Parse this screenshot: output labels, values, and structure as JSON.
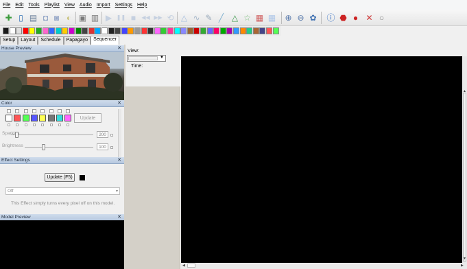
{
  "menu": [
    "File",
    "Edit",
    "Tools",
    "Playlist",
    "View",
    "Audio",
    "Import",
    "Settings",
    "Help"
  ],
  "toolbar_icons": [
    {
      "name": "new-sequence-icon",
      "glyph": "✚",
      "color": "#3a9a3a"
    },
    {
      "name": "new-document-icon",
      "glyph": "▯",
      "color": "#2d6fb5"
    },
    {
      "name": "open-folder-icon",
      "glyph": "▤",
      "color": "#6a7f9a"
    },
    {
      "name": "save-icon",
      "glyph": "◘",
      "color": "#8aa0c4"
    },
    {
      "name": "save-as-icon",
      "glyph": "◙",
      "color": "#98a8c8"
    },
    {
      "name": "refresh-icon",
      "glyph": "◐",
      "color": "#c9c27a"
    },
    {
      "name": "clipboard-icon",
      "glyph": "▣",
      "color": "#7a7a7a"
    },
    {
      "name": "paste-icon",
      "glyph": "▥",
      "color": "#777777"
    },
    {
      "name": "play-icon",
      "glyph": "▶",
      "color": "#c5d0e0"
    },
    {
      "name": "pause-icon",
      "glyph": "❚❚",
      "color": "#c5d0e0"
    },
    {
      "name": "stop-icon",
      "glyph": "■",
      "color": "#c5d0e0"
    },
    {
      "name": "rewind-icon",
      "glyph": "◀◀",
      "color": "#c5d0e0"
    },
    {
      "name": "fast-forward-icon",
      "glyph": "▶▶",
      "color": "#c5d0e0"
    },
    {
      "name": "loop-icon",
      "glyph": "⟲",
      "color": "#c5d0e0"
    },
    {
      "name": "triangle-icon",
      "glyph": "△",
      "color": "#a8c0e0"
    },
    {
      "name": "curve-icon",
      "glyph": "∿",
      "color": "#aabbcc"
    },
    {
      "name": "brush-icon",
      "glyph": "✎",
      "color": "#9aaabb"
    },
    {
      "name": "line-icon",
      "glyph": "╱",
      "color": "#7fb0d0"
    },
    {
      "name": "tree-icon",
      "glyph": "△",
      "color": "#3c9a4c"
    },
    {
      "name": "star-icon",
      "glyph": "☆",
      "color": "#7fc07f"
    },
    {
      "name": "colorful-grid-icon",
      "glyph": "▦",
      "color": "#d06060"
    },
    {
      "name": "light-grid-icon",
      "glyph": "▦",
      "color": "#b0c8e8"
    },
    {
      "name": "zoom-in-icon",
      "glyph": "⊕",
      "color": "#5577aa"
    },
    {
      "name": "zoom-out-icon",
      "glyph": "⊖",
      "color": "#5577aa"
    },
    {
      "name": "gear-icon",
      "glyph": "✿",
      "color": "#3d6fb0"
    },
    {
      "name": "info-icon",
      "glyph": "ⓘ",
      "color": "#1e5fbf"
    },
    {
      "name": "stop-sign-icon",
      "glyph": "⬣",
      "color": "#cc2222"
    },
    {
      "name": "stop-circle-icon",
      "glyph": "●",
      "color": "#cc2222"
    },
    {
      "name": "bulb-x-icon",
      "glyph": "✕",
      "color": "#cc3333"
    },
    {
      "name": "bulb-icon",
      "glyph": "○",
      "color": "#888888"
    }
  ],
  "effect_icon_colors": [
    "#1a1a1a",
    "#ffffff",
    "#e0e0e0",
    "#ff0000",
    "#ffff00",
    "#22aa22",
    "#ff66cc",
    "#3366ff",
    "#00cccc",
    "#ffcc00",
    "#cc00cc",
    "#008800",
    "#444444",
    "#dd3333",
    "#00aaff",
    "#ffffff",
    "#222222",
    "#444444",
    "#4444ff",
    "#ff9900",
    "#999999",
    "#ff3333",
    "#333333",
    "#ff66ff",
    "#33cc33",
    "#ff3399",
    "#00ffff",
    "#8888ff",
    "#996633",
    "#cc0000",
    "#33aa33",
    "#6666ff",
    "#ff0066",
    "#00aa00",
    "#aa00aa",
    "#3399ff",
    "#ff8800",
    "#22cc88",
    "#aa6633",
    "#444488",
    "#ff5555",
    "#55ff55"
  ],
  "tabs": [
    "Setup",
    "Layout",
    "Schedule",
    "Papagayo",
    "Sequencer"
  ],
  "panes": {
    "house_preview": "House Preview",
    "color": "Color",
    "effect_settings": "Effect Settings",
    "model_preview": "Model Preview"
  },
  "color_panel": {
    "swatches": [
      "#ffffff",
      "#ff5555",
      "#55ff55",
      "#5555ff",
      "#ffff55",
      "#777777",
      "#33dddd",
      "#ff66ff"
    ],
    "update_label": "Update",
    "sparkles_label": "Sparkles",
    "sparkles_value": "200",
    "sparkles_fraction": 0.05,
    "brightness_label": "Brightness",
    "brightness_value": "100",
    "brightness_fraction": 0.25
  },
  "effect_panel": {
    "update_label": "Update (F5)",
    "effect_value": "Off",
    "description": "This Effect simply turns every pixel off on this model."
  },
  "sequencer": {
    "view_label": "View:",
    "time_label": "Time:"
  },
  "close_glyph": "✕"
}
